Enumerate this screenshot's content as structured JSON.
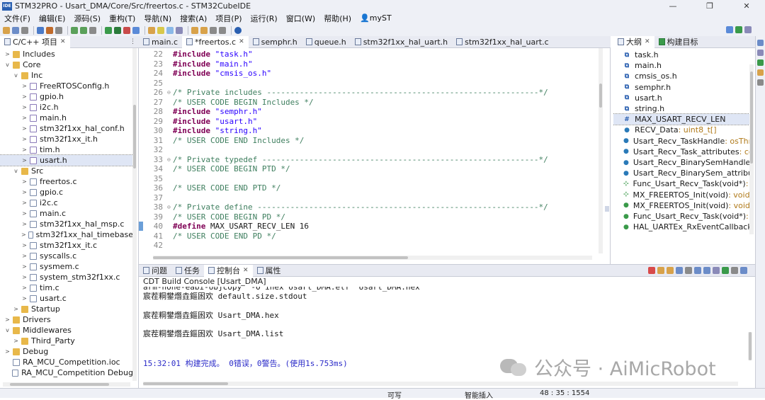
{
  "window": {
    "logo_text": "IDE",
    "title": "STM32PRO - Usart_DMA/Core/Src/freertos.c - STM32CubeIDE",
    "controls": [
      "—",
      "❐",
      "✕"
    ]
  },
  "menubar": {
    "items": [
      "文件(F)",
      "编辑(E)",
      "源码(S)",
      "重构(T)",
      "导航(N)",
      "搜索(A)",
      "项目(P)",
      "运行(R)",
      "窗口(W)",
      "帮助(H)",
      "myST"
    ]
  },
  "project_explorer": {
    "tab_label": "C/C++ 项目",
    "rows": [
      {
        "label": "Includes",
        "level": 1,
        "twisty": ">",
        "icon": "fo"
      },
      {
        "label": "Core",
        "level": 1,
        "twisty": "v",
        "icon": "fo"
      },
      {
        "label": "Inc",
        "level": 2,
        "twisty": "v",
        "icon": "fo"
      },
      {
        "label": "FreeRTOSConfig.h",
        "level": 3,
        "twisty": ">",
        "icon": "fh"
      },
      {
        "label": "gpio.h",
        "level": 3,
        "twisty": ">",
        "icon": "fh"
      },
      {
        "label": "i2c.h",
        "level": 3,
        "twisty": ">",
        "icon": "fh"
      },
      {
        "label": "main.h",
        "level": 3,
        "twisty": ">",
        "icon": "fh"
      },
      {
        "label": "stm32f1xx_hal_conf.h",
        "level": 3,
        "twisty": ">",
        "icon": "fh"
      },
      {
        "label": "stm32f1xx_it.h",
        "level": 3,
        "twisty": ">",
        "icon": "fh"
      },
      {
        "label": "tim.h",
        "level": 3,
        "twisty": ">",
        "icon": "fh"
      },
      {
        "label": "usart.h",
        "level": 3,
        "twisty": ">",
        "icon": "fh",
        "selected": true
      },
      {
        "label": "Src",
        "level": 2,
        "twisty": "v",
        "icon": "fo"
      },
      {
        "label": "freertos.c",
        "level": 3,
        "twisty": ">",
        "icon": "fc"
      },
      {
        "label": "gpio.c",
        "level": 3,
        "twisty": ">",
        "icon": "fc"
      },
      {
        "label": "i2c.c",
        "level": 3,
        "twisty": ">",
        "icon": "fc"
      },
      {
        "label": "main.c",
        "level": 3,
        "twisty": ">",
        "icon": "fc"
      },
      {
        "label": "stm32f1xx_hal_msp.c",
        "level": 3,
        "twisty": ">",
        "icon": "fc"
      },
      {
        "label": "stm32f1xx_hal_timebase",
        "level": 3,
        "twisty": ">",
        "icon": "fc"
      },
      {
        "label": "stm32f1xx_it.c",
        "level": 3,
        "twisty": ">",
        "icon": "fc"
      },
      {
        "label": "syscalls.c",
        "level": 3,
        "twisty": ">",
        "icon": "fc"
      },
      {
        "label": "sysmem.c",
        "level": 3,
        "twisty": ">",
        "icon": "fc"
      },
      {
        "label": "system_stm32f1xx.c",
        "level": 3,
        "twisty": ">",
        "icon": "fc"
      },
      {
        "label": "tim.c",
        "level": 3,
        "twisty": ">",
        "icon": "fc"
      },
      {
        "label": "usart.c",
        "level": 3,
        "twisty": ">",
        "icon": "fc"
      },
      {
        "label": "Startup",
        "level": 2,
        "twisty": ">",
        "icon": "fo"
      },
      {
        "label": "Drivers",
        "level": 1,
        "twisty": ">",
        "icon": "fo"
      },
      {
        "label": "Middlewares",
        "level": 1,
        "twisty": "v",
        "icon": "fo"
      },
      {
        "label": "Third_Party",
        "level": 2,
        "twisty": ">",
        "icon": "fo"
      },
      {
        "label": "Debug",
        "level": 1,
        "twisty": ">",
        "icon": "fo"
      },
      {
        "label": "RA_MCU_Competition.ioc",
        "level": 1,
        "twisty": "",
        "icon": "fc"
      },
      {
        "label": "RA_MCU_Competition Debug",
        "level": 1,
        "twisty": "",
        "icon": "fc"
      }
    ]
  },
  "editor": {
    "tabs": [
      {
        "label": "main.c",
        "active": false
      },
      {
        "label": "*freertos.c",
        "active": true
      },
      {
        "label": "semphr.h",
        "active": false
      },
      {
        "label": "queue.h",
        "active": false
      },
      {
        "label": "stm32f1xx_hal_uart.h",
        "active": false
      },
      {
        "label": "stm32f1xx_hal_uart.c",
        "active": false
      }
    ],
    "lines": [
      {
        "n": "22",
        "fold": "",
        "parts": [
          {
            "t": "kw",
            "s": "#include"
          },
          {
            "t": "code",
            "s": " "
          },
          {
            "t": "str",
            "s": "\"task.h\""
          }
        ]
      },
      {
        "n": "23",
        "fold": "",
        "parts": [
          {
            "t": "kw",
            "s": "#include"
          },
          {
            "t": "code",
            "s": " "
          },
          {
            "t": "str",
            "s": "\"main.h\""
          }
        ]
      },
      {
        "n": "24",
        "fold": "",
        "parts": [
          {
            "t": "kw",
            "s": "#include"
          },
          {
            "t": "code",
            "s": " "
          },
          {
            "t": "str",
            "s": "\"cmsis_os.h\""
          }
        ]
      },
      {
        "n": "25",
        "fold": "",
        "parts": []
      },
      {
        "n": "26",
        "fold": "⊖",
        "parts": [
          {
            "t": "cmt",
            "s": "/* Private includes ----------------------------------------------------------*/"
          }
        ]
      },
      {
        "n": "27",
        "fold": "",
        "parts": [
          {
            "t": "cmt",
            "s": "/* USER CODE BEGIN Includes */"
          }
        ]
      },
      {
        "n": "28",
        "fold": "",
        "parts": [
          {
            "t": "kw",
            "s": "#include"
          },
          {
            "t": "code",
            "s": " "
          },
          {
            "t": "str",
            "s": "\"semphr.h\""
          }
        ]
      },
      {
        "n": "29",
        "fold": "",
        "parts": [
          {
            "t": "kw",
            "s": "#include"
          },
          {
            "t": "code",
            "s": " "
          },
          {
            "t": "str",
            "s": "\"usart.h\""
          }
        ]
      },
      {
        "n": "30",
        "fold": "",
        "parts": [
          {
            "t": "kw",
            "s": "#include"
          },
          {
            "t": "code",
            "s": " "
          },
          {
            "t": "str",
            "s": "\"string.h\""
          }
        ]
      },
      {
        "n": "31",
        "fold": "",
        "parts": [
          {
            "t": "cmt",
            "s": "/* USER CODE END Includes */"
          }
        ]
      },
      {
        "n": "32",
        "fold": "",
        "parts": []
      },
      {
        "n": "33",
        "fold": "⊖",
        "parts": [
          {
            "t": "cmt",
            "s": "/* Private typedef -----------------------------------------------------------*/"
          }
        ]
      },
      {
        "n": "34",
        "fold": "",
        "parts": [
          {
            "t": "cmt",
            "s": "/* USER CODE BEGIN PTD */"
          }
        ]
      },
      {
        "n": "35",
        "fold": "",
        "parts": []
      },
      {
        "n": "36",
        "fold": "",
        "parts": [
          {
            "t": "cmt",
            "s": "/* USER CODE END PTD */"
          }
        ]
      },
      {
        "n": "37",
        "fold": "",
        "parts": []
      },
      {
        "n": "38",
        "fold": "⊖",
        "parts": [
          {
            "t": "cmt",
            "s": "/* Private define ------------------------------------------------------------*/"
          }
        ]
      },
      {
        "n": "39",
        "fold": "",
        "parts": [
          {
            "t": "cmt",
            "s": "/* USER CODE BEGIN PD */"
          }
        ]
      },
      {
        "n": "40",
        "fold": "",
        "marker": true,
        "parts": [
          {
            "t": "kw",
            "s": "#define"
          },
          {
            "t": "code",
            "s": " MAX_USART_RECV_LEN 16"
          }
        ]
      },
      {
        "n": "41",
        "fold": "",
        "parts": [
          {
            "t": "cmt",
            "s": "/* USER CODE END PD */"
          }
        ]
      },
      {
        "n": "42",
        "fold": "",
        "parts": []
      }
    ]
  },
  "outline": {
    "tab_label": "大纲",
    "tab2_label": "构建目标",
    "items": [
      {
        "icon": "include",
        "name": "task.h",
        "type": ""
      },
      {
        "icon": "include",
        "name": "main.h",
        "type": ""
      },
      {
        "icon": "include",
        "name": "cmsis_os.h",
        "type": ""
      },
      {
        "icon": "include",
        "name": "semphr.h",
        "type": ""
      },
      {
        "icon": "include",
        "name": "usart.h",
        "type": ""
      },
      {
        "icon": "include",
        "name": "string.h",
        "type": ""
      },
      {
        "icon": "define",
        "name": "MAX_USART_RECV_LEN",
        "type": "",
        "selected": true
      },
      {
        "icon": "var",
        "name": "RECV_Data",
        "type": " : uint8_t[]"
      },
      {
        "icon": "var",
        "name": "Usart_Recv_TaskHandle",
        "type": " : osThrea"
      },
      {
        "icon": "var-s",
        "name": "Usart_Recv_Task_attributes",
        "type": " : con"
      },
      {
        "icon": "var",
        "name": "Usart_Recv_BinarySemHandle",
        "type": " : o"
      },
      {
        "icon": "var-s",
        "name": "Usart_Recv_BinarySem_attribute",
        "type": ""
      },
      {
        "icon": "func-decl",
        "name": "Func_Usart_Recv_Task(void*)",
        "type": " : vo"
      },
      {
        "icon": "func-decl",
        "name": "MX_FREERTOS_Init(void)",
        "type": " : void"
      },
      {
        "icon": "func",
        "name": "MX_FREERTOS_Init(void)",
        "type": " : void"
      },
      {
        "icon": "func",
        "name": "Func_Usart_Recv_Task(void*)",
        "type": " : vo"
      },
      {
        "icon": "func",
        "name": "HAL_UARTEx_RxEventCallback(U",
        "type": ""
      }
    ]
  },
  "console": {
    "tabs": [
      {
        "label": "问题",
        "active": false
      },
      {
        "label": "任务",
        "active": false
      },
      {
        "label": "控制台",
        "active": true
      },
      {
        "label": "属性",
        "active": false
      }
    ],
    "title": "CDT Build Console [Usart_DMA]",
    "lines": [
      {
        "text": "arm-none-eabi-objcopy  -O ihex Usart_DMA.elf  Usart_DMA.hex",
        "style": "normal"
      },
      {
        "text": "宸茬粡鐢熸垚鏂囦欢 default.size.stdout",
        "style": "normal"
      },
      {
        "text": "",
        "style": "normal"
      },
      {
        "text": "宸茬粡鐢熸垚鏂囦欢 Usart_DMA.hex",
        "style": "normal"
      },
      {
        "text": "",
        "style": "normal"
      },
      {
        "text": "宸茬粡鐢熸垚鏂囦欢 Usart_DMA.list",
        "style": "normal"
      },
      {
        "text": "",
        "style": "normal"
      },
      {
        "text": "",
        "style": "normal"
      },
      {
        "text": "15:32:01 构建完成。 0错误，0警告。(使用1s.753ms)",
        "style": "blue"
      }
    ]
  },
  "statusbar": {
    "writable": "可写",
    "insert_mode": "智能插入",
    "position": "48 : 35 : 1554"
  },
  "watermark": {
    "text": "公众号 · AiMicRobot"
  },
  "colors": {
    "accent": "#2a5fb0",
    "keyword": "#7f0055",
    "string": "#2a00ff",
    "comment": "#3f7f5f"
  }
}
